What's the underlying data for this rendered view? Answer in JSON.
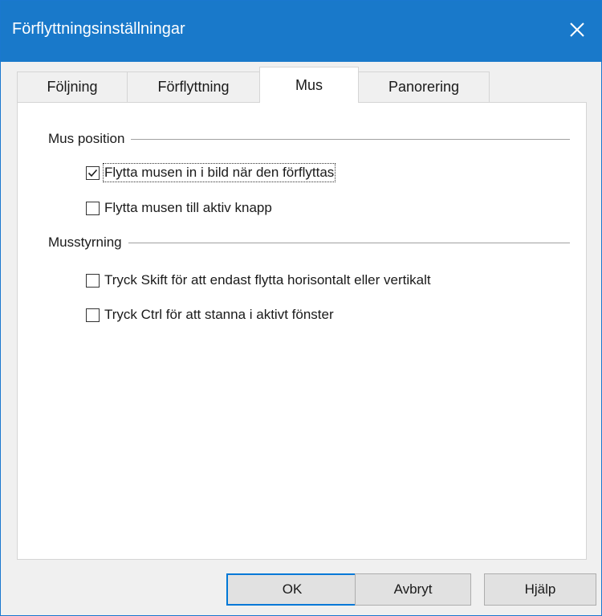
{
  "window": {
    "title": "Förflyttningsinställningar",
    "close_icon": "close-icon",
    "accent_color": "#1979ca"
  },
  "tabs": [
    {
      "label": "Följning",
      "active": false
    },
    {
      "label": "Förflyttning",
      "active": false
    },
    {
      "label": "Mus",
      "active": true
    },
    {
      "label": "Panorering",
      "active": false
    }
  ],
  "mouse_position": {
    "group_label": "Mus position",
    "options": [
      {
        "label": "Flytta musen in i bild när den förflyttas",
        "checked": true
      },
      {
        "label": "Flytta musen till aktiv knapp",
        "checked": false
      }
    ]
  },
  "mouse_control": {
    "group_label": "Musstyrning",
    "options": [
      {
        "label": "Tryck Skift för att endast flytta horisontalt eller vertikalt",
        "checked": false
      },
      {
        "label": "Tryck Ctrl för att stanna i aktivt fönster",
        "checked": false
      }
    ]
  },
  "buttons": {
    "ok": "OK",
    "cancel": "Avbryt",
    "help": "Hjälp"
  }
}
